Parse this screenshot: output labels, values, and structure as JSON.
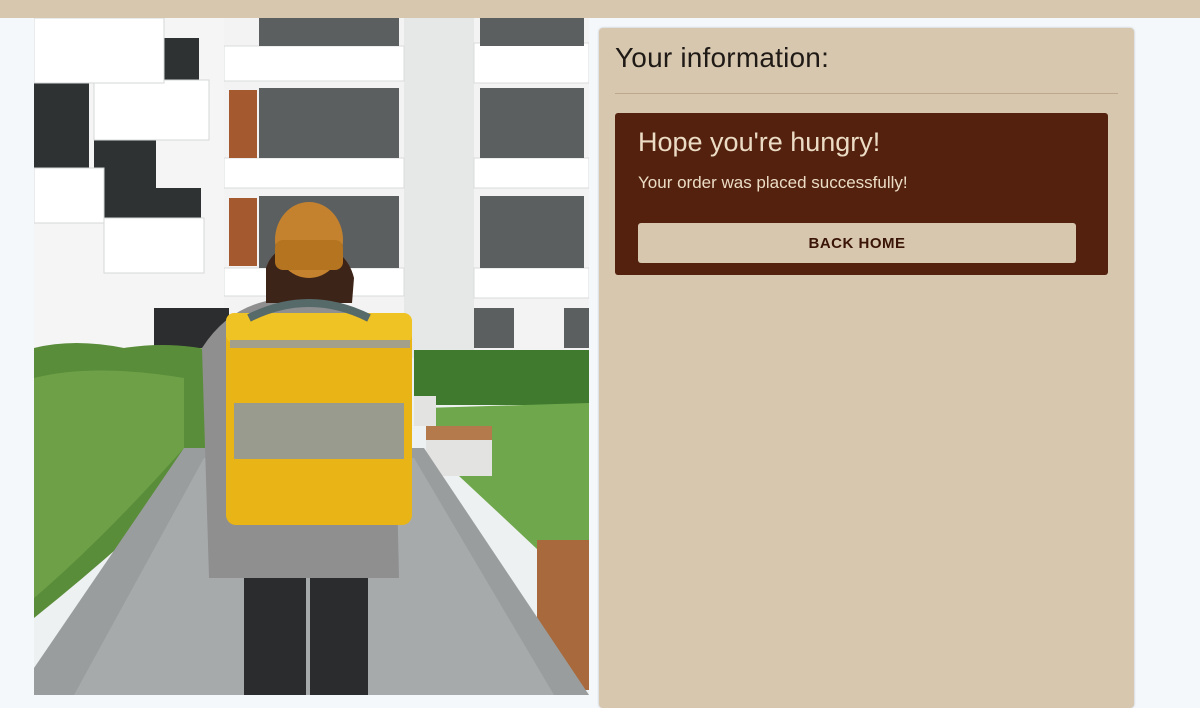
{
  "photo": {
    "alt": "Delivery courier with yellow insulated backpack walking toward an apartment building"
  },
  "info": {
    "title": "Your information:"
  },
  "order_status": {
    "heading": "Hope you're hungry!",
    "message": "Your order was placed successfully!",
    "button_label": "BACK HOME"
  },
  "colors": {
    "panel_bg": "#d7c7af",
    "card_bg": "#53210d",
    "card_text": "#ecdcc5",
    "page_bg": "#f4f8fb"
  }
}
